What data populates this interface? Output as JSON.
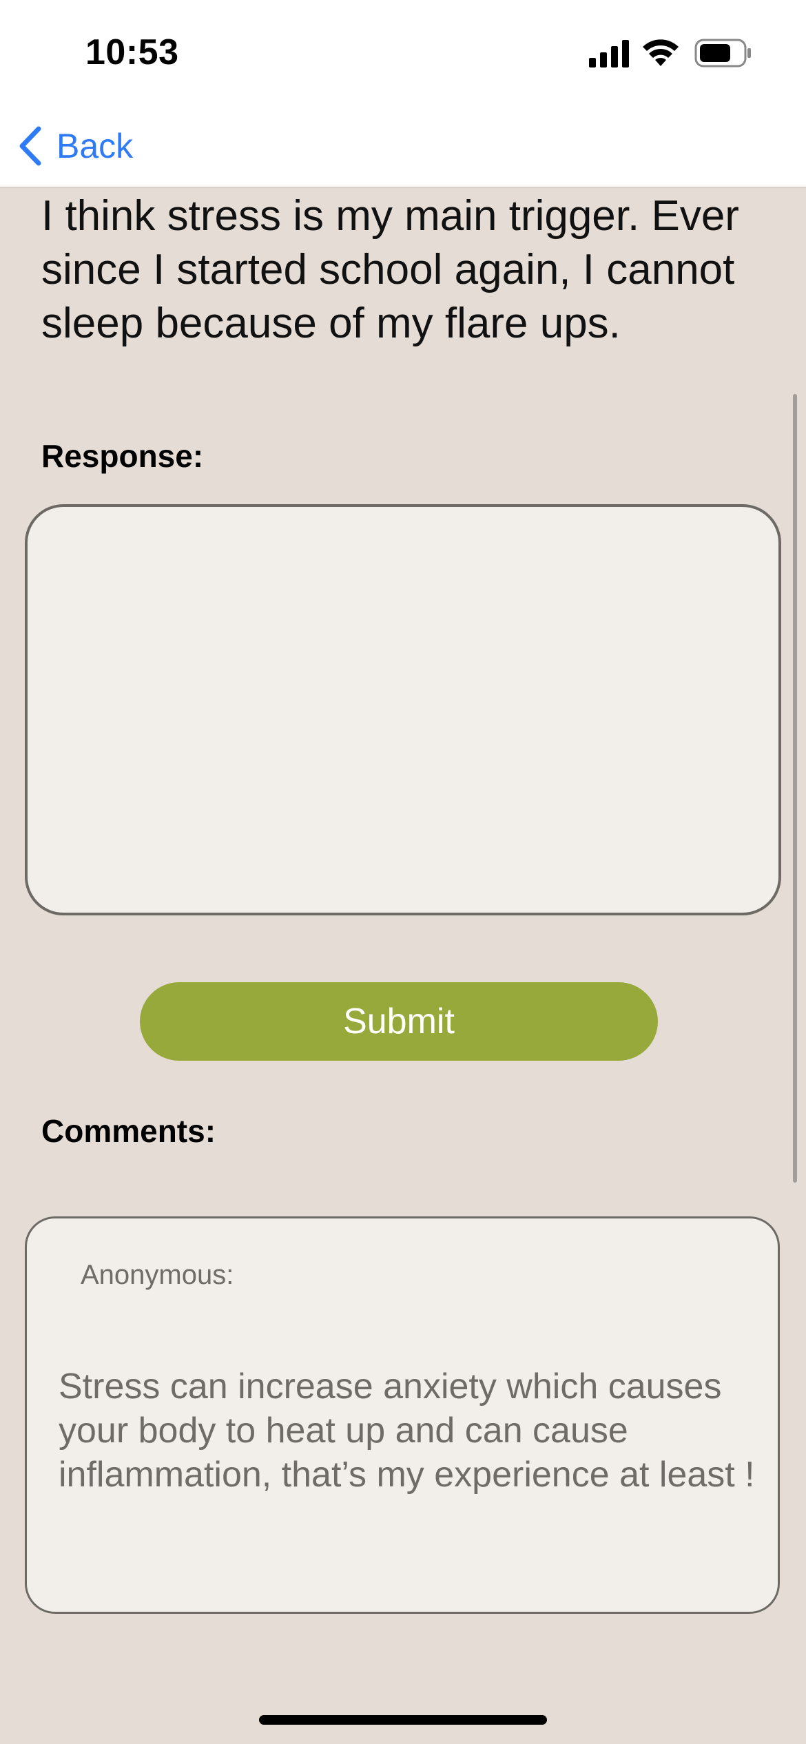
{
  "status_bar": {
    "time": "10:53"
  },
  "nav": {
    "back_label": "Back"
  },
  "post": {
    "text": "I think stress is my main trigger. Ever since I started school again, I cannot sleep because of my flare ups."
  },
  "response": {
    "label": "Response:",
    "value": "",
    "placeholder": ""
  },
  "submit_label": "Submit",
  "comments": {
    "label": "Comments:",
    "items": [
      {
        "author": "Anonymous:",
        "body": "Stress can increase anxiety which causes your body to heat up and can cause inflammation, that’s my experience at least !"
      }
    ]
  },
  "colors": {
    "background": "#e5ddd5",
    "card": "#f2efeb",
    "accent_button": "#98a93b",
    "link": "#2f7bf5"
  },
  "icons": [
    "signal-icon",
    "wifi-icon",
    "battery-icon",
    "back-chevron-icon"
  ]
}
